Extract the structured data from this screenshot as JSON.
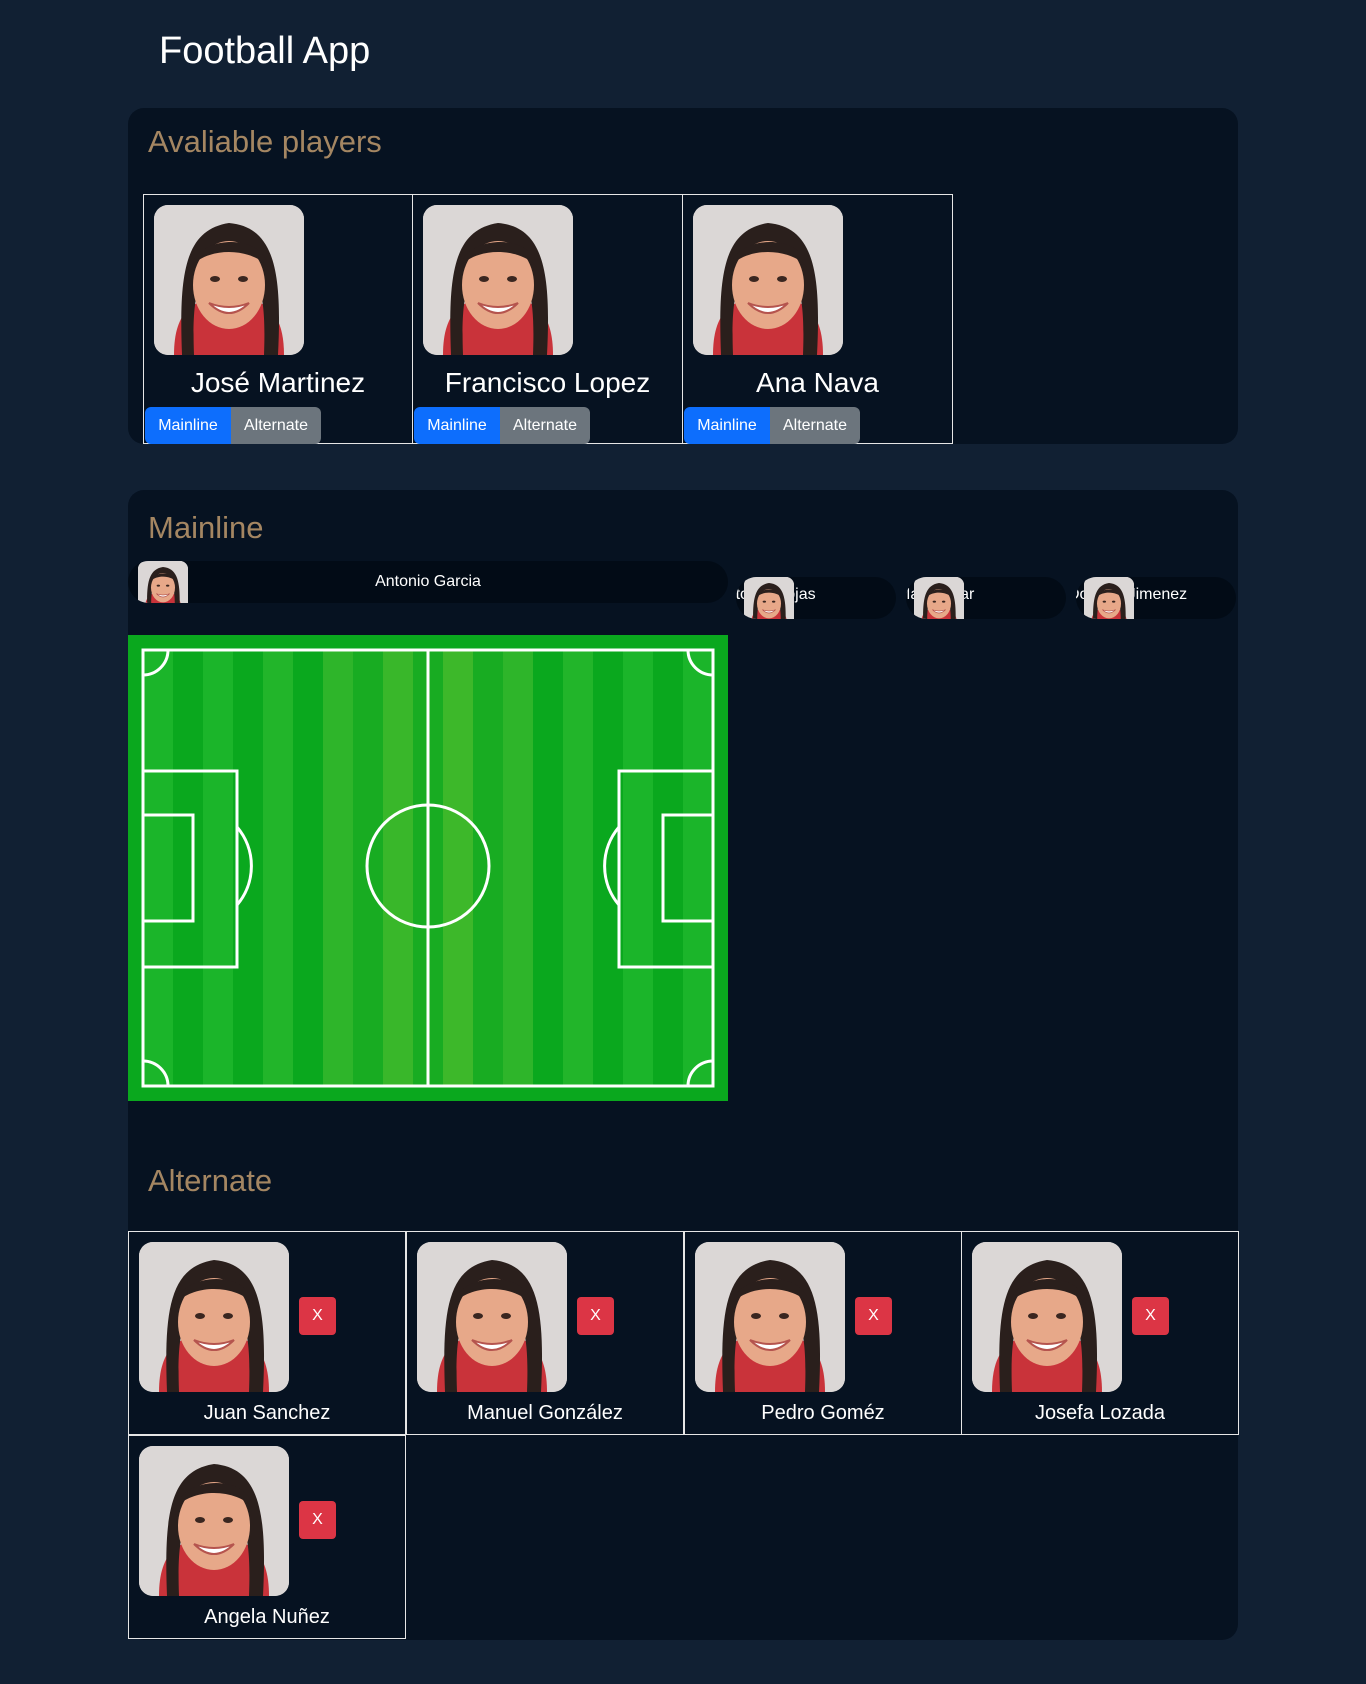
{
  "app": {
    "title": "Football App"
  },
  "available": {
    "heading": "Avaliable players",
    "players": [
      {
        "name": "José Martinez",
        "mainline_label": "Mainline",
        "alternate_label": "Alternate"
      },
      {
        "name": "Francisco Lopez",
        "mainline_label": "Mainline",
        "alternate_label": "Alternate"
      },
      {
        "name": "Ana Nava",
        "mainline_label": "Mainline",
        "alternate_label": "Alternate"
      }
    ]
  },
  "mainline": {
    "heading": "Mainline",
    "players": [
      {
        "name": "Antonio Garcia"
      },
      {
        "name": "Antonia Rojas"
      },
      {
        "name": "María Pilar"
      },
      {
        "name": "Dolores Jimenez"
      }
    ]
  },
  "alternate": {
    "heading": "Alternate",
    "remove_label": "X",
    "players": [
      {
        "name": "Juan Sanchez"
      },
      {
        "name": "Manuel González"
      },
      {
        "name": "Pedro Goméz"
      },
      {
        "name": "Josefa Lozada"
      },
      {
        "name": "Angela Nuñez"
      }
    ]
  },
  "colors": {
    "page_bg": "#112033",
    "panel_bg": "#061221",
    "heading": "#a48662",
    "primary": "#0d6efd",
    "secondary": "#6c757d",
    "danger": "#dc3545",
    "pitch_green": "#0cb024"
  }
}
